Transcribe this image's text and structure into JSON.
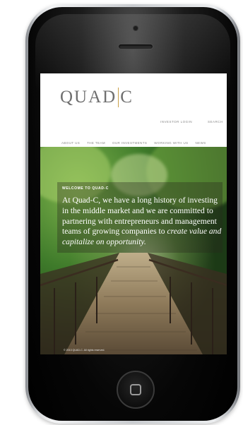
{
  "site": {
    "logo_left": "QUAD",
    "logo_right": "C",
    "investor_login": "INVESTOR LOGIN",
    "search": "SEARCH",
    "nav": [
      "ABOUT US",
      "THE TEAM",
      "OUR INVESTMENTS",
      "WORKING WITH US",
      "NEWS"
    ],
    "welcome_label": "WELCOME TO QUAD-C",
    "intro_plain": "At Quad-C, we have a long history of investing in the middle market and we are committed to partnering with entrepreneurs and management teams of growing companies to ",
    "intro_emphasis": "create value and capitalize on opportunity.",
    "copyright": "© 2013 QUAD-C. All rights reserved."
  },
  "colors": {
    "logo_text": "#6f6f6f",
    "logo_accent": "#c9a14a",
    "nav_text": "#8a8a8a"
  },
  "icons": {
    "home_button": "rounded-square-home-icon"
  }
}
